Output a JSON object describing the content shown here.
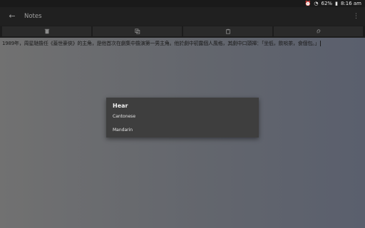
{
  "status_bar": {
    "battery_percent": "62%",
    "time": "8:16 am",
    "icons": [
      "alarm-icon",
      "wifi-icon",
      "battery-icon"
    ]
  },
  "app_bar": {
    "title": "Notes",
    "back_icon": "arrow-left-icon",
    "overflow_icon": "more-vert-icon"
  },
  "toolbar": {
    "buttons": [
      "delete-icon",
      "copy-icon",
      "paste-icon",
      "hear-icon"
    ]
  },
  "note": {
    "text": "1989年，周星馳擔任《蓋世豪俠》的主角，是他首次在劇集中擔演第一男主角。他於劇中初露個人風格，其劇中口頭禪：「坐低，飲啖茶，食個包。」"
  },
  "dialog": {
    "title": "Hear",
    "options": [
      "Cantonese",
      "Mandarin"
    ]
  },
  "colors": {
    "app_bar_bg": "#202020",
    "dialog_bg": "#3e3e3e",
    "editor_bg_left": "#717171",
    "editor_bg_right": "#5a5f6d"
  }
}
